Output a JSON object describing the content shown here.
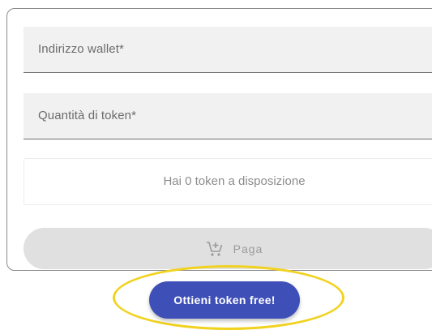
{
  "form": {
    "wallet_placeholder": "Indirizzo wallet*",
    "quantity_placeholder": "Quantità di token*",
    "balance_text": "Hai 0 token a disposizione",
    "pay_label": "Paga",
    "pay_icon": "add-shopping-cart-icon"
  },
  "cta": {
    "label": "Ottieni token free!"
  },
  "colors": {
    "cta_background": "#3e4fb8",
    "highlight": "#f1d21f",
    "field_background": "#f1f1f1",
    "disabled_button": "#e0e0e0"
  }
}
